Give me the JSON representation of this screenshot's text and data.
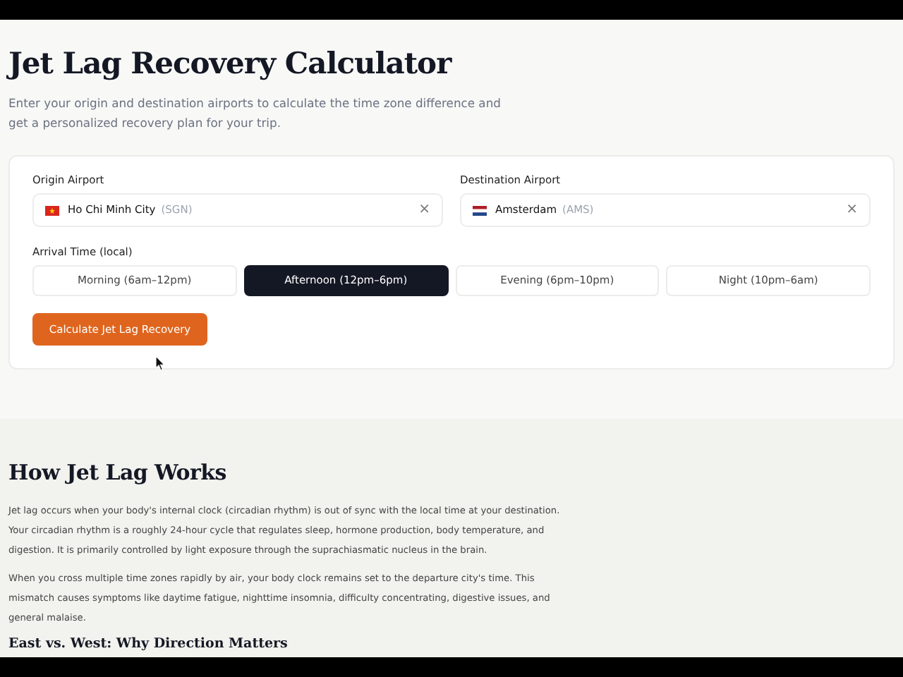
{
  "title": "Jet Lag Recovery Calculator",
  "subtitle": "Enter your origin and destination airports to calculate the time zone difference and get a personalized recovery plan for your trip.",
  "form": {
    "origin": {
      "label": "Origin Airport",
      "city": "Ho Chi Minh City",
      "code": "(SGN)",
      "clear": "×"
    },
    "destination": {
      "label": "Destination Airport",
      "city": "Amsterdam",
      "code": "(AMS)",
      "clear": "×"
    },
    "arrival_time": {
      "label": "Arrival Time (local)",
      "options": [
        {
          "label": "Morning (6am–12pm)",
          "selected": false
        },
        {
          "label": "Afternoon (12pm–6pm)",
          "selected": true
        },
        {
          "label": "Evening (6pm–10pm)",
          "selected": false
        },
        {
          "label": "Night (10pm–6am)",
          "selected": false
        }
      ]
    },
    "submit": "Calculate Jet Lag Recovery"
  },
  "info": {
    "heading": "How Jet Lag Works",
    "paragraphs": [
      "Jet lag occurs when your body's internal clock (circadian rhythm) is out of sync with the local time at your destination. Your circadian rhythm is a roughly 24-hour cycle that regulates sleep, hormone production, body temperature, and digestion. It is primarily controlled by light exposure through the suprachiasmatic nucleus in the brain.",
      "When you cross multiple time zones rapidly by air, your body clock remains set to the departure city's time. This mismatch causes symptoms like daytime fatigue, nighttime insomnia, difficulty concentrating, digestive issues, and general malaise."
    ],
    "subheading": "East vs. West: Why Direction Matters"
  }
}
